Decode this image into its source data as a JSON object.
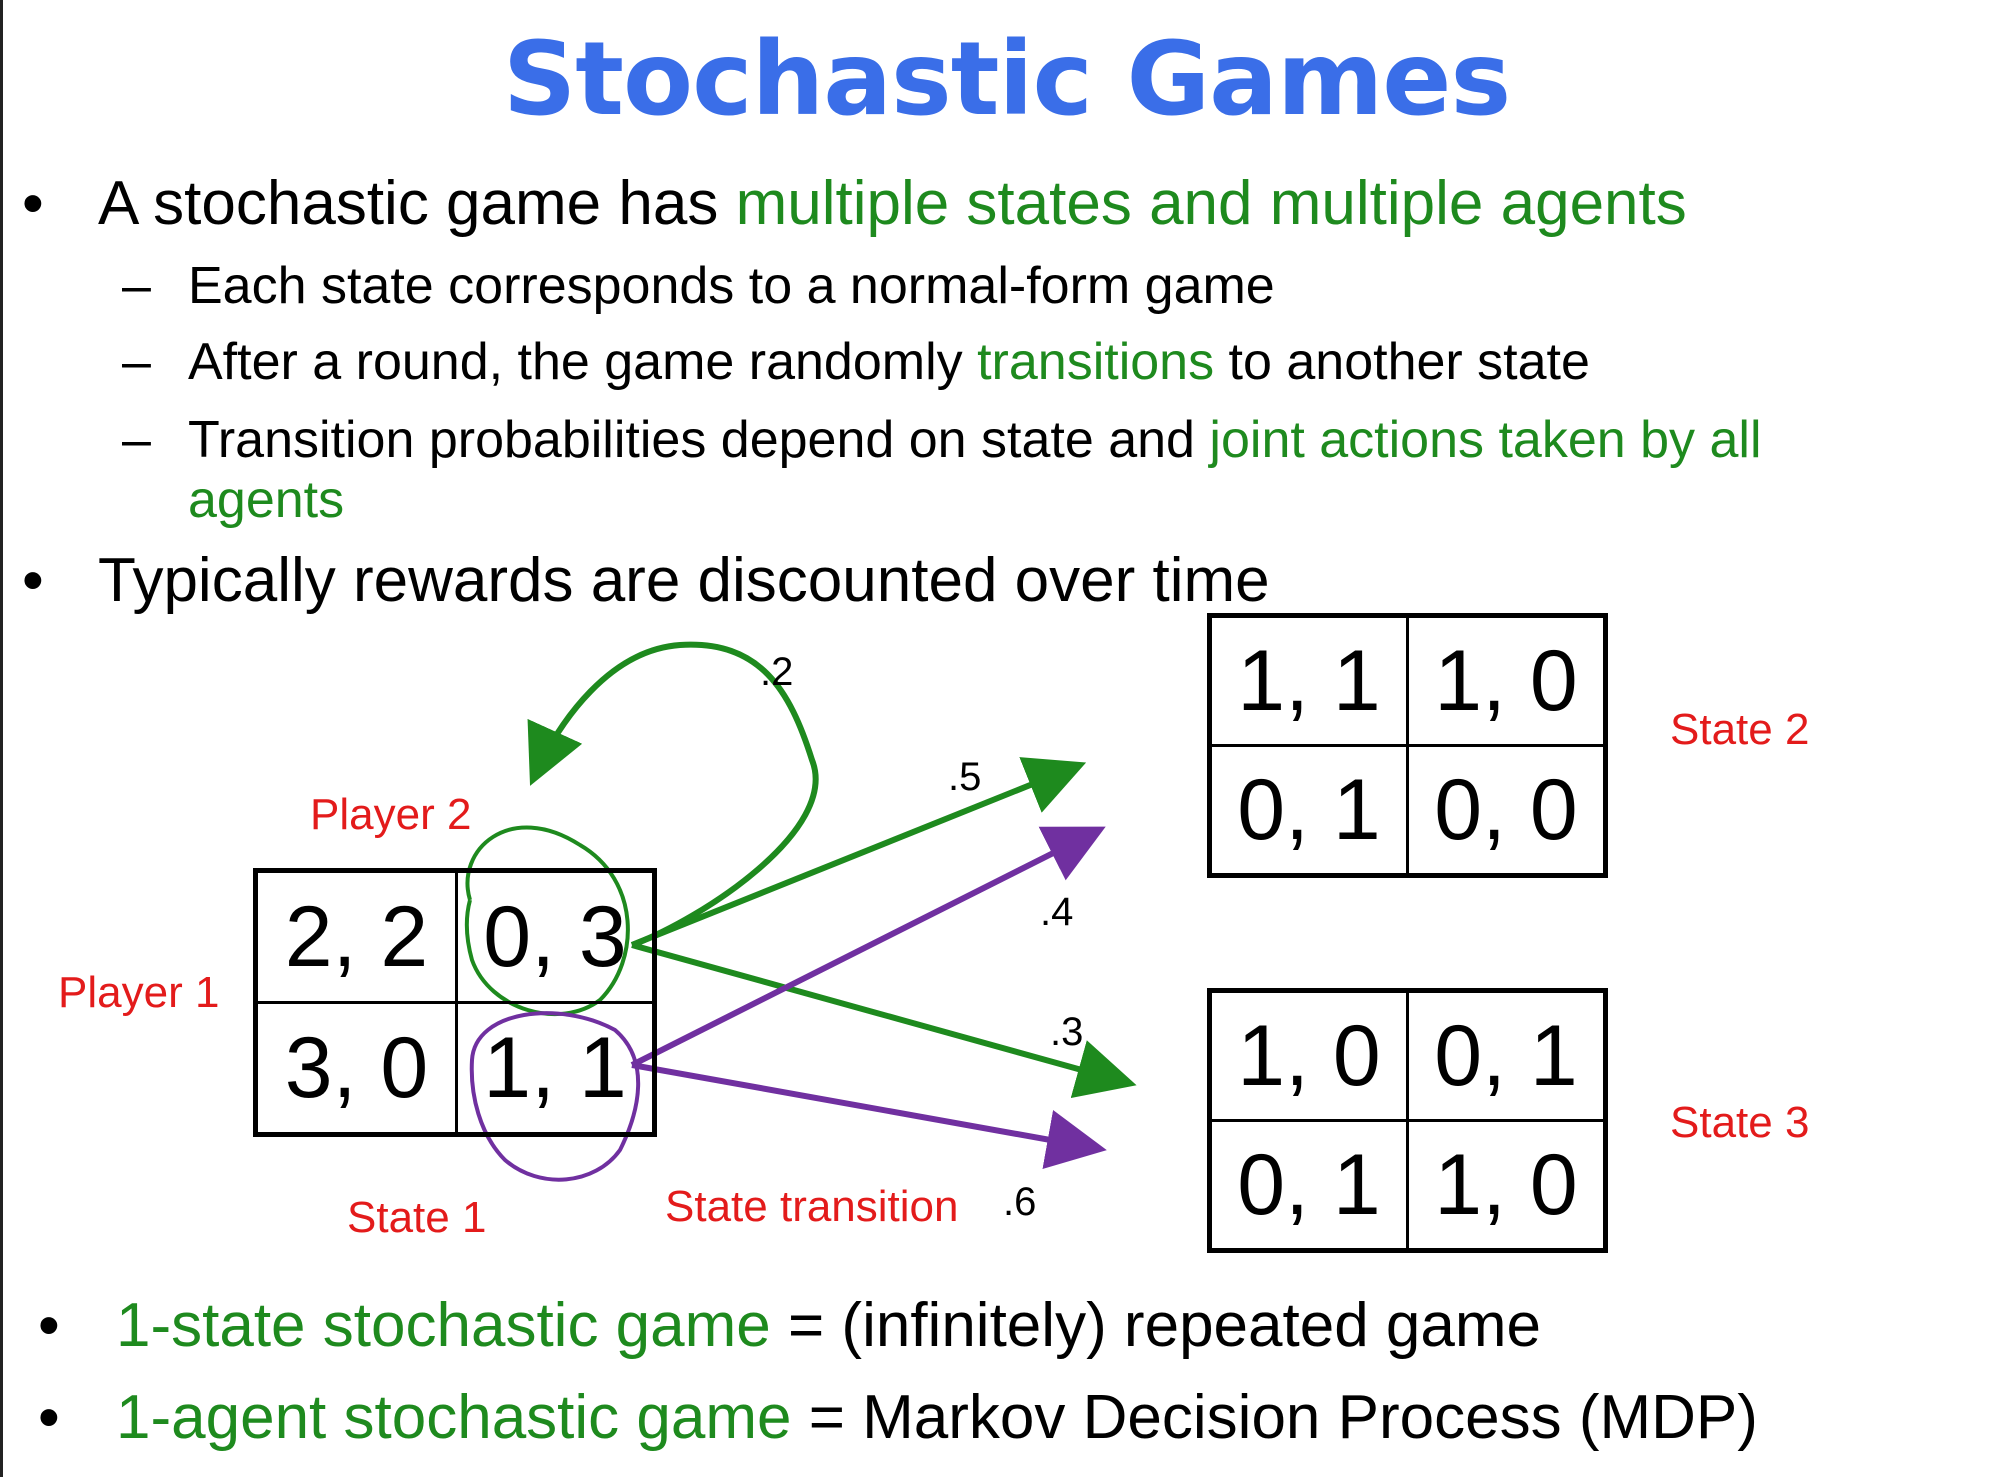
{
  "title": "Stochastic Games",
  "bullets": {
    "b1_a": "A stochastic game has ",
    "b1_b": "multiple states and multiple agents",
    "s1": "Each state corresponds to a normal-form game",
    "s2_a": "After a round, the game randomly ",
    "s2_b": "transitions",
    "s2_c": " to another state",
    "s3_a": "Transition probabilities depend on state and ",
    "s3_b": "joint actions taken by all",
    "s3_c": "agents",
    "b2": "Typically rewards are discounted over time",
    "b3_a": "1-state stochastic game",
    "b3_b": " = (infinitely) repeated game",
    "b4_a": "1-agent stochastic game",
    "b4_b": " = Markov Decision Process (MDP)",
    "dot": "•",
    "dash": "–"
  },
  "labels": {
    "player2": "Player 2",
    "player1": "Player 1",
    "state1": "State 1",
    "state2": "State 2",
    "state3": "State 3",
    "transition": "State transition"
  },
  "probabilities": {
    "p_self": ".2",
    "p_to2_green": ".5",
    "p_to2_purple": ".4",
    "p_to3_green": ".3",
    "p_to3_purple": ".6"
  },
  "games": {
    "state1": [
      [
        "2, 2",
        "0, 3"
      ],
      [
        "3, 0",
        "1, 1"
      ]
    ],
    "state2": [
      [
        "1, 1",
        "1, 0"
      ],
      [
        "0, 1",
        "0, 0"
      ]
    ],
    "state3": [
      [
        "1, 0",
        "0, 1"
      ],
      [
        "0, 1",
        "1, 0"
      ]
    ]
  },
  "colors": {
    "title": "#3a6ee8",
    "green": "#1e8a1e",
    "red": "#e31b1b",
    "purple": "#7030a0"
  }
}
